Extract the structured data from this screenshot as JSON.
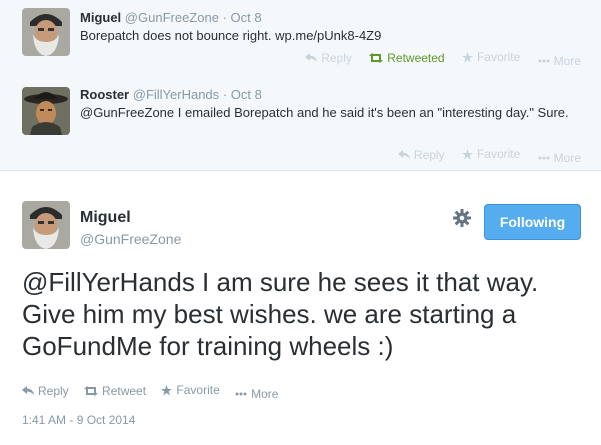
{
  "tweets": [
    {
      "fullname": "Miguel",
      "handle": "@GunFreeZone",
      "separator": "·",
      "time": "Oct 8",
      "text": "Borepatch does not bounce right. wp.me/pUnk8-4Z9",
      "actions": {
        "reply": "Reply",
        "retweet": "Retweeted",
        "favorite": "Favorite",
        "more": "More"
      }
    },
    {
      "fullname": "Rooster",
      "handle": "@FillYerHands",
      "separator": "·",
      "time": "Oct 8",
      "text": "@GunFreeZone I emailed Borepatch and he said it's been an \"interesting day.\" Sure.",
      "actions": {
        "reply": "Reply",
        "favorite": "Favorite",
        "more": "More"
      }
    }
  ],
  "main": {
    "fullname": "Miguel",
    "handle": "@GunFreeZone",
    "follow_label": "Following",
    "text": "@FillYerHands I am sure he sees it that way. Give him my best wishes. we are starting a GoFundMe for training wheels :)",
    "actions": {
      "reply": "Reply",
      "retweet": "Retweet",
      "favorite": "Favorite",
      "more": "More"
    },
    "timestamp": "1:41 AM - 9 Oct 2014"
  },
  "colors": {
    "follow_button": "#55acee",
    "retweeted": "#609928",
    "muted": "#8899a6",
    "context_bg": "#f5f8fa"
  }
}
